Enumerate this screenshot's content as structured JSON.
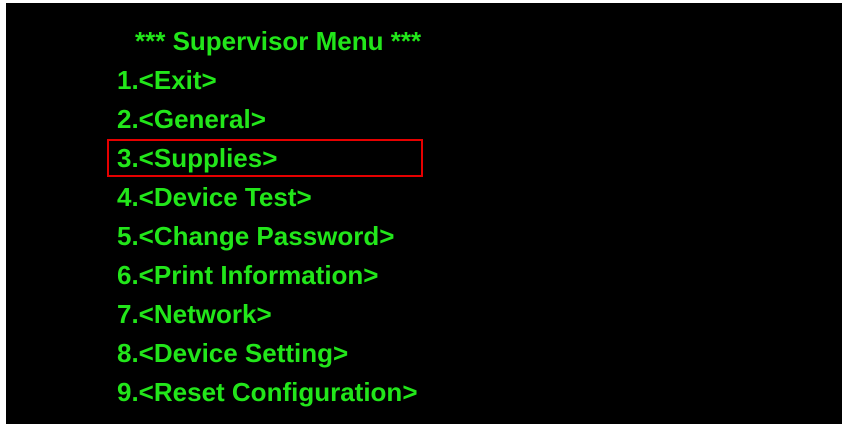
{
  "menu": {
    "title": "*** Supervisor Menu ***",
    "items": [
      {
        "label": "1.<Exit>"
      },
      {
        "label": "2.<General>"
      },
      {
        "label": "3.<Supplies>",
        "selected": true
      },
      {
        "label": "4.<Device Test>"
      },
      {
        "label": "5.<Change Password>"
      },
      {
        "label": "6.<Print Information>"
      },
      {
        "label": "7.<Network>"
      },
      {
        "label": "8.<Device Setting>"
      },
      {
        "label": "9.<Reset Configuration>"
      }
    ]
  },
  "colors": {
    "background": "#000000",
    "text": "#22e61a",
    "highlight_border": "#e60000"
  }
}
